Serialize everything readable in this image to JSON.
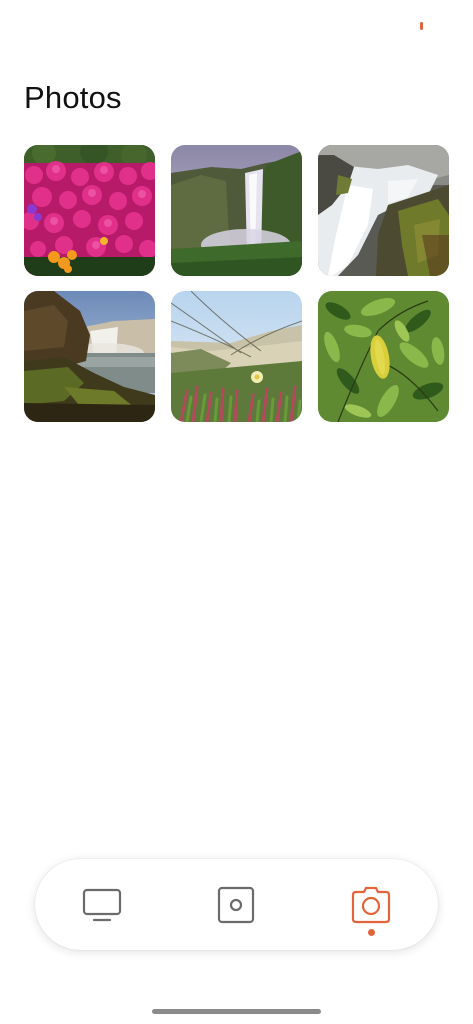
{
  "colors": {
    "accent": "#e2643a",
    "icon_inactive": "#6b6b6b",
    "background": "#ffffff"
  },
  "header": {
    "title": "Photos"
  },
  "photos": [
    {
      "name": "pink-flowers-photo"
    },
    {
      "name": "waterfall-valley-photo"
    },
    {
      "name": "rapids-waterfall-photo"
    },
    {
      "name": "cliff-waterfall-photo"
    },
    {
      "name": "dune-grass-photo"
    },
    {
      "name": "green-leaves-photo"
    }
  ],
  "tab_bar": {
    "tabs": [
      {
        "icon": "tv-icon",
        "active": false
      },
      {
        "icon": "camera-device-icon",
        "active": false
      },
      {
        "icon": "camera-icon",
        "active": true
      }
    ]
  }
}
